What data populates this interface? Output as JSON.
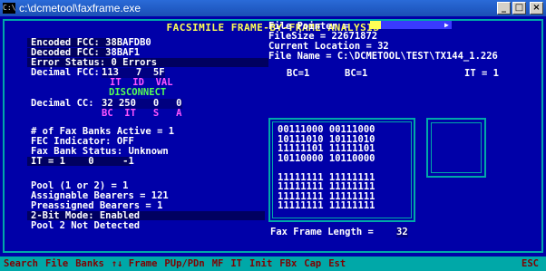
{
  "window": {
    "title": "c:\\dcmetool\\faxframe.exe",
    "icon": "C:\\",
    "buttons": [
      "_",
      "□",
      "×"
    ]
  },
  "header": "FACSIMILE FRAME-BY-FRAME ANALYSIS",
  "left": {
    "encoded_fcc": "Encoded FCC: 38BAFDB0",
    "decoded_fcc": "Decoded FCC: 38BAF1",
    "error_status": "Error Status: 0 Errors",
    "decimal_fcc_label": "Decimal FCC:",
    "decimal_fcc_values": "113   7  5F",
    "fcc_fields": "IT  ID  VAL",
    "disconnect": "DISCONNECT",
    "decimal_cc_label": "Decimal CC:",
    "decimal_cc_values": "32 250   0   0",
    "cc_fields": "BC  IT   S   A",
    "fax_banks": "# of Fax Banks Active = 1",
    "fec": "FEC Indicator: OFF",
    "fax_bank_status": "Fax Bank Status: Unknown",
    "it_line": "IT = 1    0     -1",
    "pool": "Pool (1 or 2) = 1",
    "assignable": "Assignable Bearers = 121",
    "preassigned": "Preassigned Bearers = 1",
    "two_bit": "2-Bit Mode: Enabled",
    "pool2": "Pool 2 Not Detected"
  },
  "right": {
    "file_pointer": "File Pointer =",
    "file_size": "FileSize = 22671872",
    "current_location": "Current Location = 32",
    "file_name": "File Name = C:\\DCMETOOL\\TEST\\TX144_1.226",
    "bc_header_1": "BC=1",
    "bc_header_2": "BC=1",
    "it_header": "IT = 1",
    "bits": [
      "00111000 00111000",
      "10111010 10111010",
      "11111101 11111101",
      "10110000 10110000",
      "",
      "11111111 11111111",
      "11111111 11111111",
      "11111111 11111111",
      "11111111 11111111"
    ],
    "fax_frame_length_label": "Fax Frame Length =",
    "fax_frame_length_value": "32"
  },
  "menu": [
    "Search",
    "File",
    "Banks",
    "↑↓ Frame",
    "PUp/PDn",
    "MF",
    "IT",
    "Init",
    "FBx",
    "Cap",
    "Est",
    "ESC"
  ]
}
